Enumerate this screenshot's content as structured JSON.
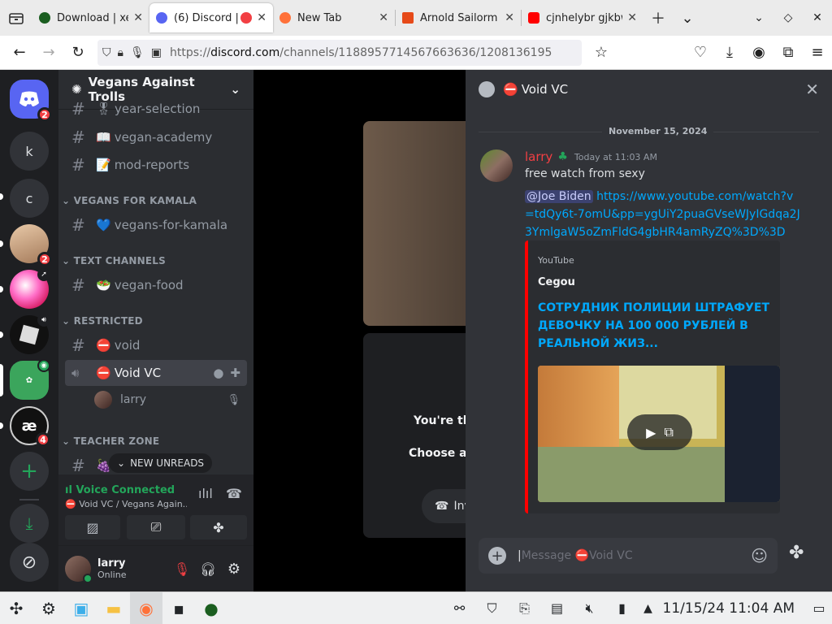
{
  "browser": {
    "tabs": [
      {
        "title": "Download | xe",
        "color": "#1b5e20"
      },
      {
        "title": "(6) Discord | ",
        "color": "#5865f2"
      },
      {
        "title": "New Tab",
        "color": "#ff7139"
      },
      {
        "title": "Arnold Sailorm",
        "color": "#e64a19"
      },
      {
        "title": "cjnhelybr gjkbw",
        "color": "#ff0000"
      }
    ],
    "url_prefix": "https://",
    "url_domain": "discord.com",
    "url_path": "/channels/1188957714567663636/1208136195"
  },
  "guild": {
    "name": "Vegans Against Trolls",
    "channels_top": [
      {
        "emoji": "🎖",
        "name": "year-selection"
      },
      {
        "emoji": "📖",
        "name": "vegan-academy"
      },
      {
        "emoji": "📝",
        "name": "mod-reports"
      }
    ],
    "cat_kamala": "VEGANS FOR KAMALA",
    "kamala_channel": {
      "emoji": "💙",
      "name": "vegans-for-kamala"
    },
    "cat_text": "TEXT CHANNELS",
    "food_channel": {
      "emoji": "🥗",
      "name": "vegan-food"
    },
    "cat_restricted": "RESTRICTED",
    "void_channel": {
      "emoji": "⛔",
      "name": "void"
    },
    "voidvc_channel": {
      "emoji": "⛔",
      "name": "Void VC"
    },
    "voice_member": "larry",
    "cat_teacher": "TEACHER ZONE",
    "new_unreads": "NEW UNREADS"
  },
  "servers": [
    {
      "label": "k"
    },
    {
      "label": "c"
    }
  ],
  "badges": {
    "home": "2",
    "avatar": "2",
    "ae": "4"
  },
  "voice": {
    "status": "Voice Connected",
    "location": "Void VC / Vegans Again..."
  },
  "user": {
    "name": "larry",
    "status": "Online"
  },
  "behind": {
    "line1": "You're the",
    "line2": "Choose an",
    "invite": "Inv"
  },
  "chat": {
    "title": "Void VC",
    "date_divider": "November 15, 2024",
    "author": "larry",
    "timestamp": "Today at 11:03 AM",
    "text": "free watch from sexy",
    "mention": "@Joe Biden",
    "url": "https://www.youtube.com/watch?v=tdQy6t-7omU&pp=ygUiY2puaGVseWJyIGdqa2J3YmlgaW5oZmFldG4gbHR4amRyZQ%3D%3D",
    "embed": {
      "provider": "YouTube",
      "author": "Cegou",
      "title": "СОТРУДНИК ПОЛИЦИИ ШТРАФУЕТ ДЕВОЧКУ НА 100 000 РУБЛЕЙ В РЕАЛЬНОЙ ЖИЗ..."
    },
    "placeholder_prefix": "Message",
    "placeholder_channel": "Void VC"
  },
  "taskbar": {
    "clock": "11/15/24 11:04 AM"
  },
  "colors": {
    "discord_blurple": "#5865f2",
    "danger": "#f23f43",
    "online": "#23a55a",
    "link": "#00a8fc",
    "author": "#f23f43"
  }
}
